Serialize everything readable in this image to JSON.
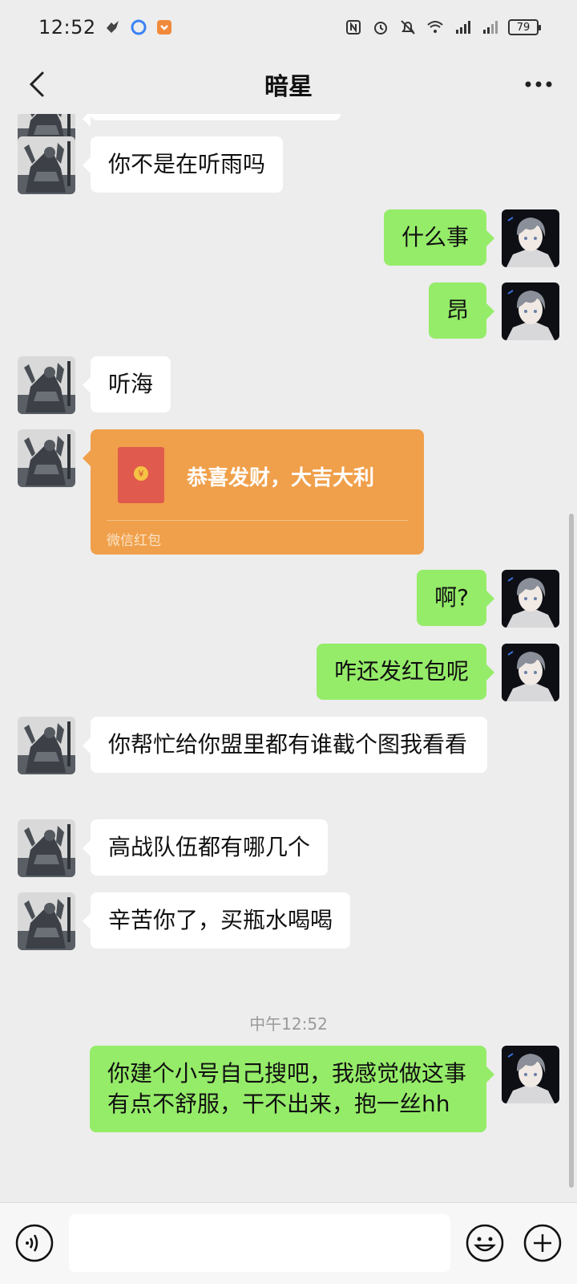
{
  "status_bar": {
    "time": "12:52",
    "battery": "79"
  },
  "header": {
    "title": "暗星"
  },
  "messages": {
    "m1": "你不是在听雨吗",
    "m2": "什么事",
    "m3": "昂",
    "m4": "听海",
    "m5": {
      "title": "恭喜发财，大吉大利",
      "label": "微信红包"
    },
    "m6": "啊?",
    "m7": "咋还发红包呢",
    "m8": "你帮忙给你盟里都有谁截个图我看看",
    "m9": "高战队伍都有哪几个",
    "m10": "辛苦你了，买瓶水喝喝",
    "timestamp": "中午12:52",
    "m11": "你建个小号自己搜吧，我感觉做这事有点不舒服，干不出来，抱一丝hh"
  },
  "input": {
    "value": ""
  },
  "colors": {
    "bg": "#ededed",
    "self_bubble": "#95ec69",
    "other_bubble": "#ffffff",
    "red_packet": "#f0a04b"
  }
}
